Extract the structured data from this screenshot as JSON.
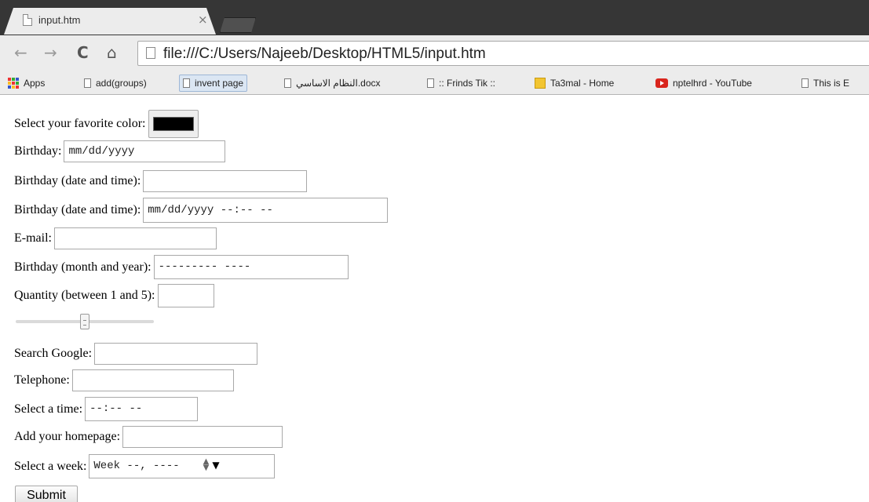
{
  "browser": {
    "tab_title": "input.htm",
    "tab_close": "×",
    "url": "file:///C:/Users/Najeeb/Desktop/HTML5/input.htm",
    "nav": {
      "back": "←",
      "forward": "→",
      "reload": "C",
      "home": "⌂"
    }
  },
  "bookmarks": [
    "Apps",
    "add(groups)",
    "invent page",
    "النظام الاساسي.docx",
    ":: Frinds Tik ::",
    "Ta3mal - Home",
    "nptelhrd - YouTube",
    "This is E"
  ],
  "form": {
    "color_label": "Select your favorite color:",
    "color_value": "#000000",
    "birthday_label": "Birthday:",
    "birthday_value": "mm/dd/yyyy",
    "birthday_datetime_label": "Birthday (date and time):",
    "birthday_datetime_local_label": "Birthday (date and time):",
    "birthday_datetime_local_value": "mm/dd/yyyy --:-- --",
    "email_label": "E-mail:",
    "month_label": "Birthday (month and year):",
    "month_value": "--------- ----",
    "quantity_label": "Quantity (between 1 and 5):",
    "range_value": 0.5,
    "search_label": "Search Google:",
    "telephone_label": "Telephone:",
    "time_label": "Select a time:",
    "time_value": "--:-- --",
    "homepage_label": "Add your homepage:",
    "week_label": "Select a week:",
    "week_value": "Week --, ----",
    "submit_label": "Submit"
  }
}
